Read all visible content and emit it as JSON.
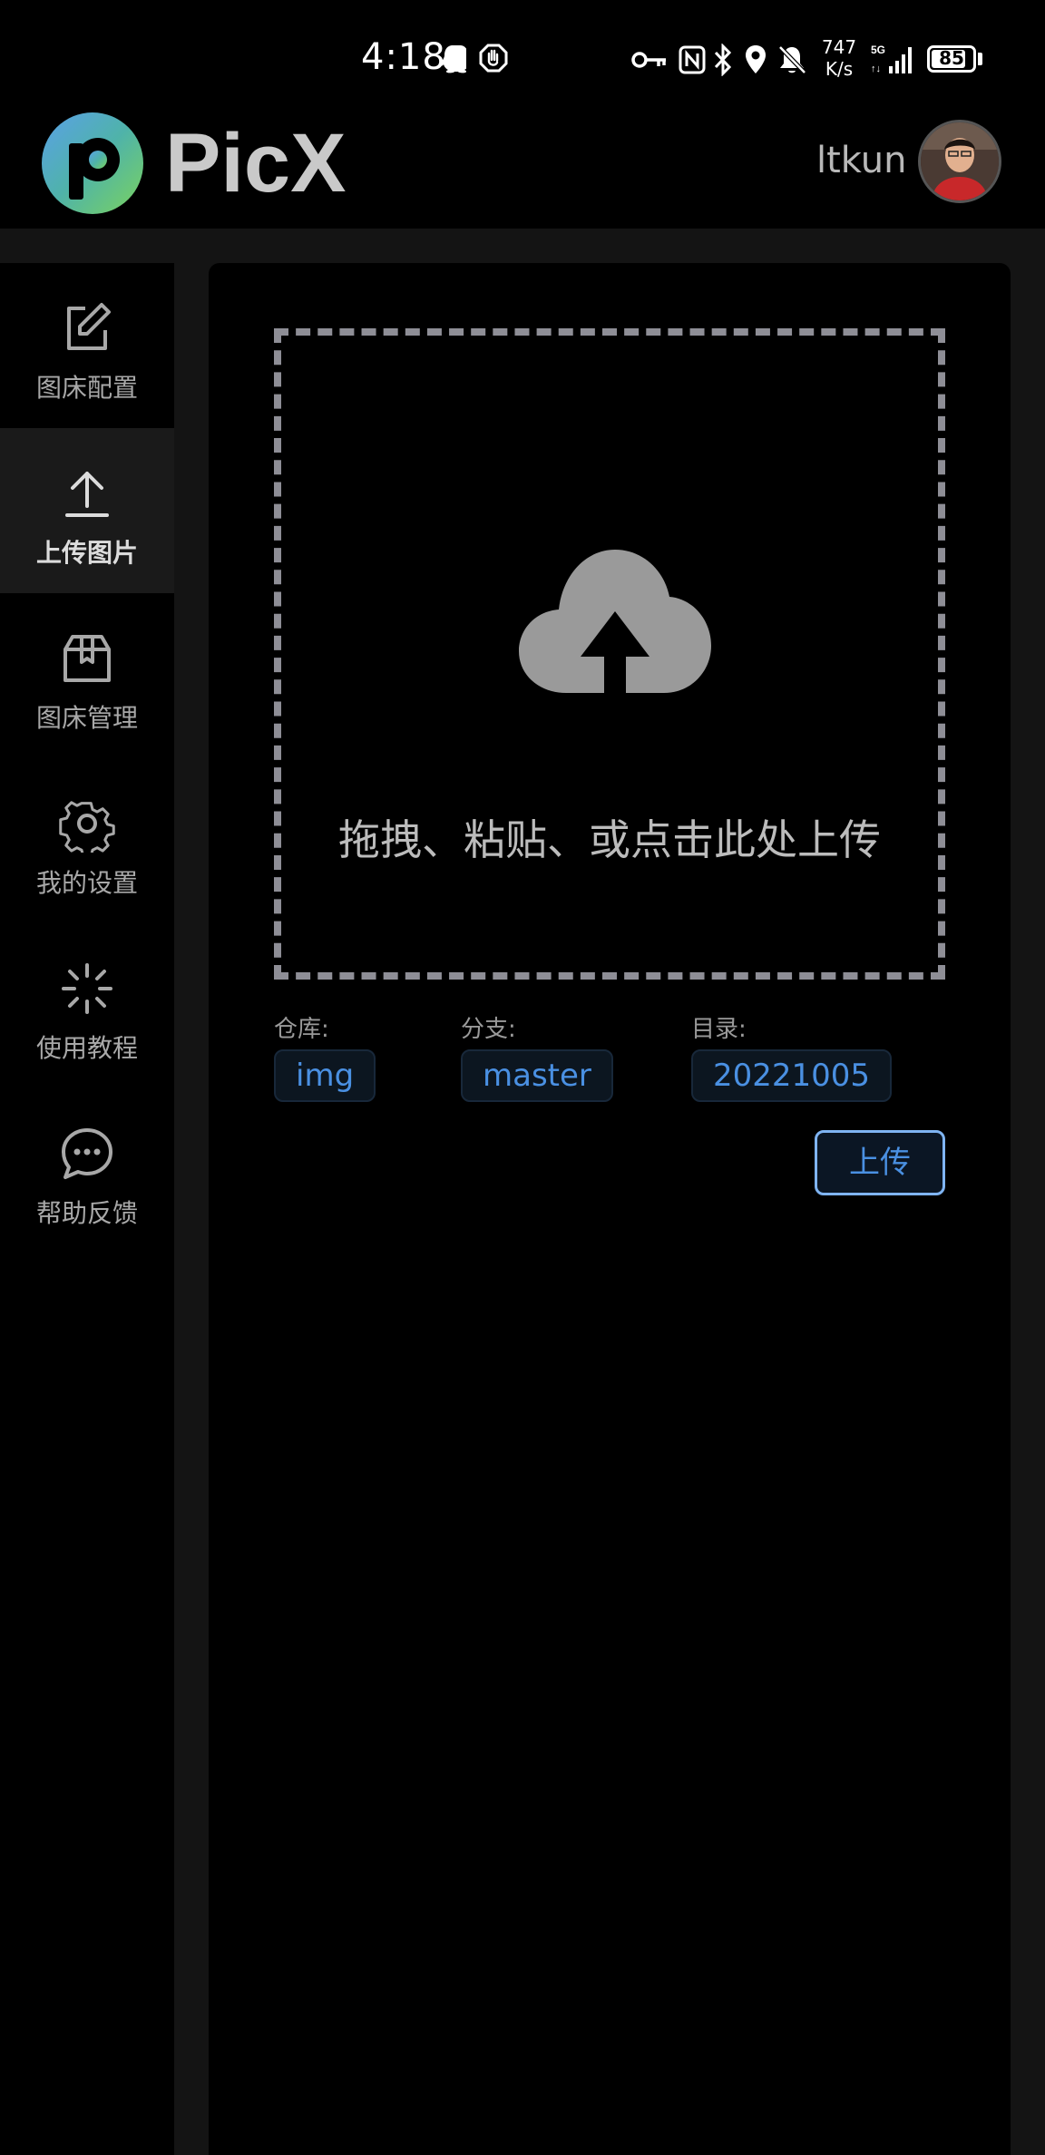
{
  "status_bar": {
    "time": "4:18",
    "net_speed_value": "747",
    "net_speed_unit": "K/s",
    "battery": "85",
    "battery_level": 0.85,
    "icons": [
      "qq-icon",
      "hand-icon",
      "key-icon",
      "nfc-icon",
      "bluetooth-icon",
      "location-icon",
      "mute-icon",
      "signal-5g-icon"
    ]
  },
  "header": {
    "app_name": "PicX",
    "username": "ltkun"
  },
  "sidebar": {
    "items": [
      {
        "label": "图床配置",
        "icon": "edit-icon",
        "active": false
      },
      {
        "label": "上传图片",
        "icon": "upload-icon",
        "active": true
      },
      {
        "label": "图床管理",
        "icon": "box-icon",
        "active": false
      },
      {
        "label": "我的设置",
        "icon": "gear-icon",
        "active": false
      },
      {
        "label": "使用教程",
        "icon": "sparkle-icon",
        "active": false
      },
      {
        "label": "帮助反馈",
        "icon": "chat-icon",
        "active": false
      }
    ]
  },
  "upload": {
    "drop_text": "拖拽、粘贴、或点击此处上传",
    "repo_label": "仓库:",
    "repo_value": "img",
    "branch_label": "分支:",
    "branch_value": "master",
    "dir_label": "目录:",
    "dir_value": "20221005",
    "upload_button": "上传"
  },
  "colors": {
    "accent": "#4a90e2",
    "background": "#000000",
    "frame": "#141414",
    "dashed_border": "#8e8e96"
  }
}
